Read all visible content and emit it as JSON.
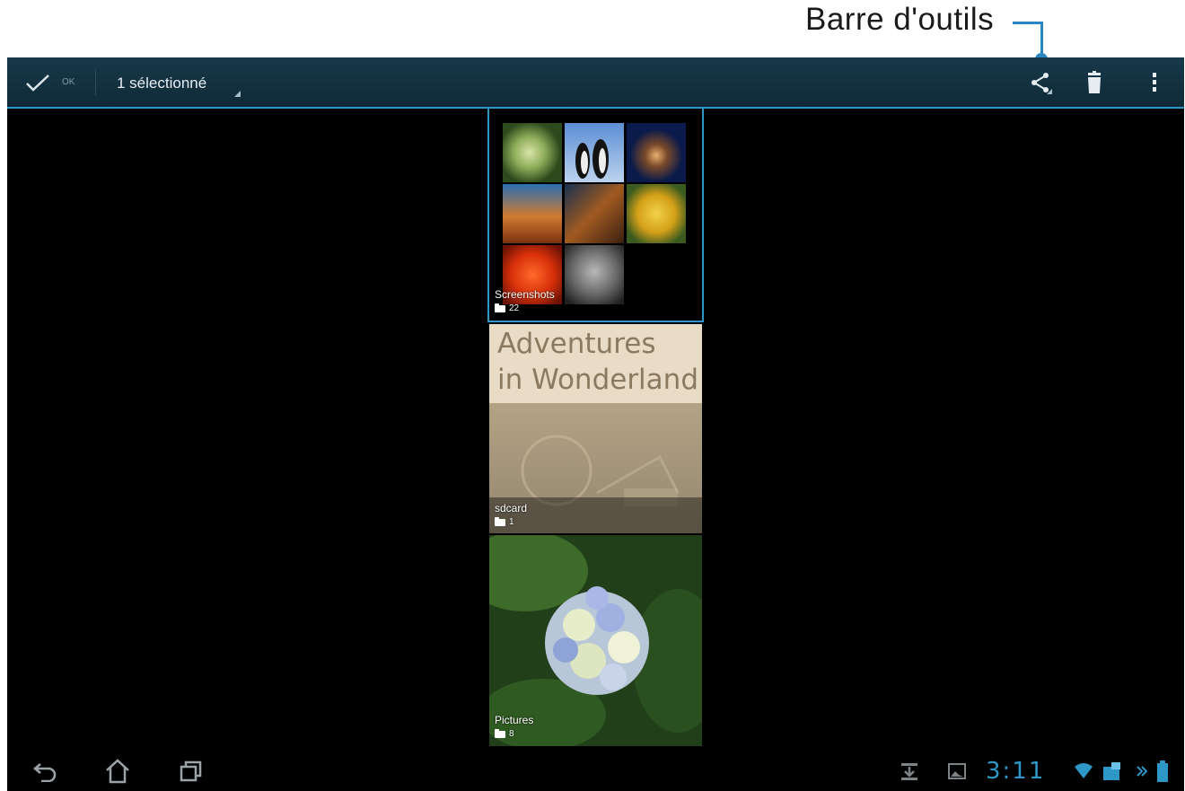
{
  "annotation": {
    "label": "Barre d'outils",
    "accent_color": "#2a86c2"
  },
  "action_bar": {
    "done_label": "OK",
    "selection_count": "1 sélectionné",
    "icons": [
      "check-icon",
      "share-icon",
      "trash-icon",
      "overflow-menu-icon"
    ]
  },
  "albums": [
    {
      "name": "Screenshots",
      "count": "22",
      "selected": true
    },
    {
      "name": "sdcard",
      "count": "1",
      "cover_text_line1": "Adventures",
      "cover_text_line2": "in Wonderland"
    },
    {
      "name": "Pictures",
      "count": "8"
    }
  ],
  "navbar": {
    "icons": [
      "back-icon",
      "home-icon",
      "recent-apps-icon"
    ]
  },
  "status_bar": {
    "time": "3:11",
    "icons": [
      "download-icon",
      "gallery-icon",
      "wifi-icon",
      "dock-icon",
      "battery-icon"
    ]
  }
}
